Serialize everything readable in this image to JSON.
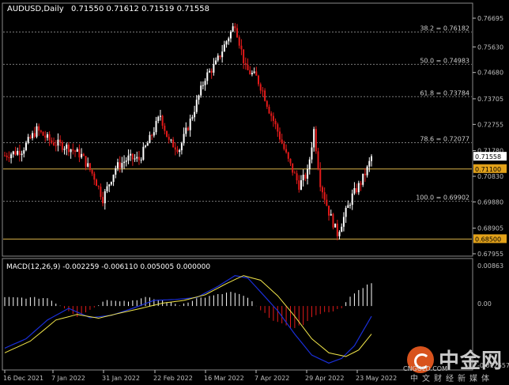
{
  "header": {
    "symbol": "AUDUSD,Daily",
    "ohlc": "0.71550 0.71612 0.71519 0.71558"
  },
  "colors": {
    "bg": "#000000",
    "grid": "#7a7a7a",
    "bull": "#ffffff",
    "bear": "#e21a1a",
    "fibline": "#d8b24a",
    "label_bg": "#e3a21a",
    "axis": "#bfbfbf",
    "macd_line": "#1a2fd8",
    "signal_line": "#f2e64a"
  },
  "price_axis": {
    "labels": [
      "0.76695",
      "0.75630",
      "0.74680",
      "0.73705",
      "0.72755",
      "0.71780",
      "0.70830",
      "0.69880",
      "0.68905",
      "0.67955"
    ],
    "current": "0.71558"
  },
  "fib_levels": [
    {
      "label": "38.2 = 0.76182"
    },
    {
      "label": "50.0 = 0.74983"
    },
    {
      "label": "61.8 = 0.73784"
    },
    {
      "label": "78.6 = 0.72077"
    },
    {
      "label": "100.0 = 0.69902"
    }
  ],
  "hlines": [
    {
      "label": "0.71100",
      "value": 0.711
    },
    {
      "label": "0.68500",
      "value": 0.685
    }
  ],
  "macd": {
    "label": "MACD(12,26,9) -0.002259 -0.006110 0.005005 0.000000",
    "axis_top": "0.00863",
    "axis_zero": "0.00",
    "axis_bottom": "-0.012657"
  },
  "x_axis": [
    "16 Dec 2021",
    "7 Jan 2022",
    "31 Jan 2022",
    "22 Feb 2022",
    "16 Mar 2022",
    "7 Apr 2022",
    "29 Apr 2022",
    "23 May 2022"
  ],
  "watermark": {
    "brand": "中金网",
    "url": "CNGOLD.COM",
    "sub": "中文财经新媒体"
  }
}
